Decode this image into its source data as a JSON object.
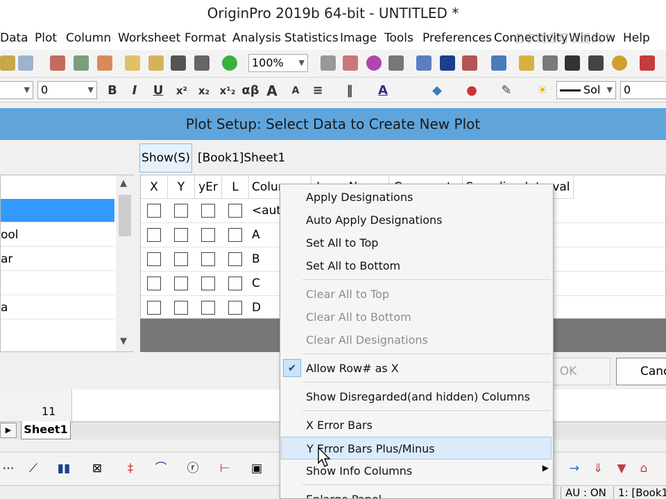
{
  "window": {
    "title": "OriginPro 2019b 64-bit - UNTITLED *"
  },
  "menu": {
    "items": [
      "Data",
      "Plot",
      "Column",
      "Worksheet",
      "Format",
      "Analysis",
      "Statistics",
      "Image",
      "Tools",
      "Preferences",
      "Connectivity",
      "Window",
      "Help"
    ],
    "watermark": "名字利应可以提只个"
  },
  "toolbar1": {
    "zoom": "100%"
  },
  "toolbar2": {
    "font_size": "0",
    "line_style": "Sol",
    "line_width": "0",
    "bold": "B",
    "italic": "I",
    "underline": "U",
    "greek": "αβ"
  },
  "dialog": {
    "title": "Plot Setup: Select Data to Create New Plot",
    "show_button": "Show(S)",
    "book_path": "[Book1]Sheet1",
    "tree_items": [
      "",
      "ool",
      "ar",
      "",
      "a"
    ],
    "grid_headers": [
      "X",
      "Y",
      "yEr",
      "L",
      "Colur",
      "Long Name",
      "Comments",
      "Sampling Interval"
    ],
    "rows": [
      "<auto>",
      "A",
      "B",
      "C",
      "D"
    ],
    "ok": "OK",
    "cancel": "Canc"
  },
  "worksheet": {
    "row_number": "11",
    "sheet_tab": "Sheet1"
  },
  "status": {
    "au": "AU : ON",
    "book": "1: [Book1"
  },
  "context_menu": {
    "items": [
      {
        "label": "Apply Designations",
        "enabled": true
      },
      {
        "label": "Auto Apply Designations",
        "enabled": true
      },
      {
        "label": "Set All to Top",
        "enabled": true
      },
      {
        "label": "Set All to Bottom",
        "enabled": true
      },
      {
        "label": "Clear All to Top",
        "enabled": false
      },
      {
        "label": "Clear All to Bottom",
        "enabled": false
      },
      {
        "label": "Clear All Designations",
        "enabled": false
      },
      {
        "label": "Allow Row# as X",
        "enabled": true,
        "checked": true
      },
      {
        "label": "Show Disregarded(and hidden) Columns",
        "enabled": true
      },
      {
        "label": "X Error Bars",
        "enabled": true
      },
      {
        "label": "Y Error Bars Plus/Minus",
        "enabled": true,
        "hovered": true
      },
      {
        "label": "Show Info Columns",
        "enabled": true,
        "submenu": true
      },
      {
        "label": "Enlarge Panel",
        "enabled": true
      }
    ]
  },
  "colors": {
    "dialog_title": "#5fa5dc",
    "selection": "#3399ff",
    "menu_hover": "#dcebfb"
  }
}
